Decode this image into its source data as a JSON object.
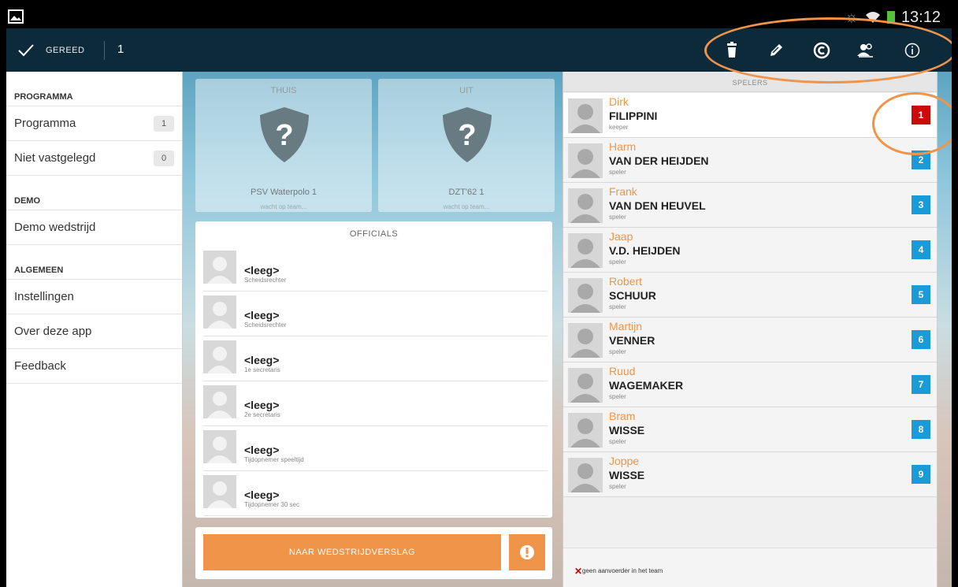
{
  "status_bar": {
    "clock": "13:12"
  },
  "action_bar": {
    "done_label": "GEREED",
    "count": "1",
    "icons": [
      "trash-icon",
      "pencil-icon",
      "copyright-icon",
      "people-icon",
      "info-icon"
    ]
  },
  "nav": {
    "sections": [
      {
        "header": "PROGRAMMA",
        "items": [
          {
            "label": "Programma",
            "badge": "1"
          },
          {
            "label": "Niet vastgelegd",
            "badge": "0"
          }
        ]
      },
      {
        "header": "DEMO",
        "items": [
          {
            "label": "Demo wedstrijd"
          }
        ]
      },
      {
        "header": "ALGEMEEN",
        "items": [
          {
            "label": "Instellingen"
          },
          {
            "label": "Over deze app"
          },
          {
            "label": "Feedback"
          }
        ]
      }
    ]
  },
  "home_team": {
    "label": "THUIS",
    "name": "PSV Waterpolo 1",
    "status": "wacht op team..."
  },
  "away_team": {
    "label": "UIT",
    "name": "DZT'62 1",
    "status": "wacht op team..."
  },
  "officials": {
    "title": "OFFICIALS",
    "rows": [
      {
        "name": "<leeg>",
        "role": "Scheidsrechter"
      },
      {
        "name": "<leeg>",
        "role": "Scheidsrechter"
      },
      {
        "name": "<leeg>",
        "role": "1e secretaris"
      },
      {
        "name": "<leeg>",
        "role": "2e secretaris"
      },
      {
        "name": "<leeg>",
        "role": "Tijdopnemer speeltijd"
      },
      {
        "name": "<leeg>",
        "role": "Tijdopnemer 30 sec"
      }
    ]
  },
  "report_button": "NAAR WEDSTRIJDVERSLAG",
  "players": {
    "title": "SPELERS",
    "rows": [
      {
        "first": "Dirk",
        "last": "FILIPPINI",
        "role": "keeper",
        "number": "1",
        "color": "#cc0a0a"
      },
      {
        "first": "Harm",
        "last": "VAN DER HEIJDEN",
        "role": "speler",
        "number": "2",
        "color": "#1a9bd7"
      },
      {
        "first": "Frank",
        "last": "VAN DEN HEUVEL",
        "role": "speler",
        "number": "3",
        "color": "#1a9bd7"
      },
      {
        "first": "Jaap",
        "last": "V.D. HEIJDEN",
        "role": "speler",
        "number": "4",
        "color": "#1a9bd7"
      },
      {
        "first": "Robert",
        "last": "SCHUUR",
        "role": "speler",
        "number": "5",
        "color": "#1a9bd7"
      },
      {
        "first": "Martijn",
        "last": "VENNER",
        "role": "speler",
        "number": "6",
        "color": "#1a9bd7"
      },
      {
        "first": "Ruud",
        "last": "WAGEMAKER",
        "role": "speler",
        "number": "7",
        "color": "#1a9bd7"
      },
      {
        "first": "Bram",
        "last": "WISSE",
        "role": "speler",
        "number": "8",
        "color": "#1a9bd7"
      },
      {
        "first": "Joppe",
        "last": "WISSE",
        "role": "speler",
        "number": "9",
        "color": "#1a9bd7"
      }
    ],
    "footer_note": "geen aanvoerder in het team"
  },
  "colors": {
    "accent": "#f0944a",
    "actionbar": "#0d2a3b",
    "number_default": "#1a9bd7",
    "number_keeper": "#cc0a0a"
  }
}
